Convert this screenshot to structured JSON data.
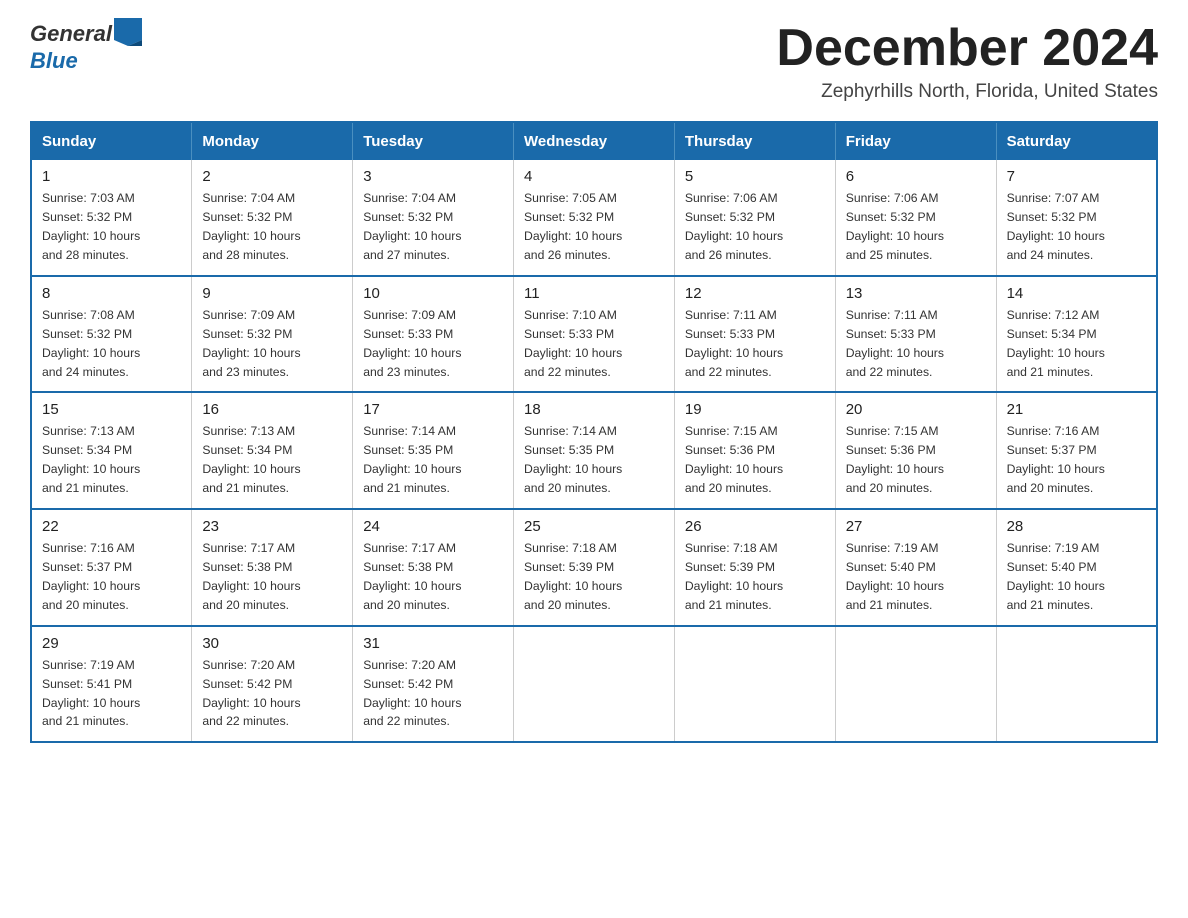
{
  "logo": {
    "text_general": "General",
    "text_blue": "Blue",
    "alt": "GeneralBlue logo"
  },
  "title": "December 2024",
  "subtitle": "Zephyrhills North, Florida, United States",
  "headers": [
    "Sunday",
    "Monday",
    "Tuesday",
    "Wednesday",
    "Thursday",
    "Friday",
    "Saturday"
  ],
  "weeks": [
    [
      {
        "day": "1",
        "sunrise": "7:03 AM",
        "sunset": "5:32 PM",
        "daylight": "10 hours and 28 minutes."
      },
      {
        "day": "2",
        "sunrise": "7:04 AM",
        "sunset": "5:32 PM",
        "daylight": "10 hours and 28 minutes."
      },
      {
        "day": "3",
        "sunrise": "7:04 AM",
        "sunset": "5:32 PM",
        "daylight": "10 hours and 27 minutes."
      },
      {
        "day": "4",
        "sunrise": "7:05 AM",
        "sunset": "5:32 PM",
        "daylight": "10 hours and 26 minutes."
      },
      {
        "day": "5",
        "sunrise": "7:06 AM",
        "sunset": "5:32 PM",
        "daylight": "10 hours and 26 minutes."
      },
      {
        "day": "6",
        "sunrise": "7:06 AM",
        "sunset": "5:32 PM",
        "daylight": "10 hours and 25 minutes."
      },
      {
        "day": "7",
        "sunrise": "7:07 AM",
        "sunset": "5:32 PM",
        "daylight": "10 hours and 24 minutes."
      }
    ],
    [
      {
        "day": "8",
        "sunrise": "7:08 AM",
        "sunset": "5:32 PM",
        "daylight": "10 hours and 24 minutes."
      },
      {
        "day": "9",
        "sunrise": "7:09 AM",
        "sunset": "5:32 PM",
        "daylight": "10 hours and 23 minutes."
      },
      {
        "day": "10",
        "sunrise": "7:09 AM",
        "sunset": "5:33 PM",
        "daylight": "10 hours and 23 minutes."
      },
      {
        "day": "11",
        "sunrise": "7:10 AM",
        "sunset": "5:33 PM",
        "daylight": "10 hours and 22 minutes."
      },
      {
        "day": "12",
        "sunrise": "7:11 AM",
        "sunset": "5:33 PM",
        "daylight": "10 hours and 22 minutes."
      },
      {
        "day": "13",
        "sunrise": "7:11 AM",
        "sunset": "5:33 PM",
        "daylight": "10 hours and 22 minutes."
      },
      {
        "day": "14",
        "sunrise": "7:12 AM",
        "sunset": "5:34 PM",
        "daylight": "10 hours and 21 minutes."
      }
    ],
    [
      {
        "day": "15",
        "sunrise": "7:13 AM",
        "sunset": "5:34 PM",
        "daylight": "10 hours and 21 minutes."
      },
      {
        "day": "16",
        "sunrise": "7:13 AM",
        "sunset": "5:34 PM",
        "daylight": "10 hours and 21 minutes."
      },
      {
        "day": "17",
        "sunrise": "7:14 AM",
        "sunset": "5:35 PM",
        "daylight": "10 hours and 21 minutes."
      },
      {
        "day": "18",
        "sunrise": "7:14 AM",
        "sunset": "5:35 PM",
        "daylight": "10 hours and 20 minutes."
      },
      {
        "day": "19",
        "sunrise": "7:15 AM",
        "sunset": "5:36 PM",
        "daylight": "10 hours and 20 minutes."
      },
      {
        "day": "20",
        "sunrise": "7:15 AM",
        "sunset": "5:36 PM",
        "daylight": "10 hours and 20 minutes."
      },
      {
        "day": "21",
        "sunrise": "7:16 AM",
        "sunset": "5:37 PM",
        "daylight": "10 hours and 20 minutes."
      }
    ],
    [
      {
        "day": "22",
        "sunrise": "7:16 AM",
        "sunset": "5:37 PM",
        "daylight": "10 hours and 20 minutes."
      },
      {
        "day": "23",
        "sunrise": "7:17 AM",
        "sunset": "5:38 PM",
        "daylight": "10 hours and 20 minutes."
      },
      {
        "day": "24",
        "sunrise": "7:17 AM",
        "sunset": "5:38 PM",
        "daylight": "10 hours and 20 minutes."
      },
      {
        "day": "25",
        "sunrise": "7:18 AM",
        "sunset": "5:39 PM",
        "daylight": "10 hours and 20 minutes."
      },
      {
        "day": "26",
        "sunrise": "7:18 AM",
        "sunset": "5:39 PM",
        "daylight": "10 hours and 21 minutes."
      },
      {
        "day": "27",
        "sunrise": "7:19 AM",
        "sunset": "5:40 PM",
        "daylight": "10 hours and 21 minutes."
      },
      {
        "day": "28",
        "sunrise": "7:19 AM",
        "sunset": "5:40 PM",
        "daylight": "10 hours and 21 minutes."
      }
    ],
    [
      {
        "day": "29",
        "sunrise": "7:19 AM",
        "sunset": "5:41 PM",
        "daylight": "10 hours and 21 minutes."
      },
      {
        "day": "30",
        "sunrise": "7:20 AM",
        "sunset": "5:42 PM",
        "daylight": "10 hours and 22 minutes."
      },
      {
        "day": "31",
        "sunrise": "7:20 AM",
        "sunset": "5:42 PM",
        "daylight": "10 hours and 22 minutes."
      },
      null,
      null,
      null,
      null
    ]
  ],
  "labels": {
    "sunrise": "Sunrise:",
    "sunset": "Sunset:",
    "daylight": "Daylight:"
  }
}
